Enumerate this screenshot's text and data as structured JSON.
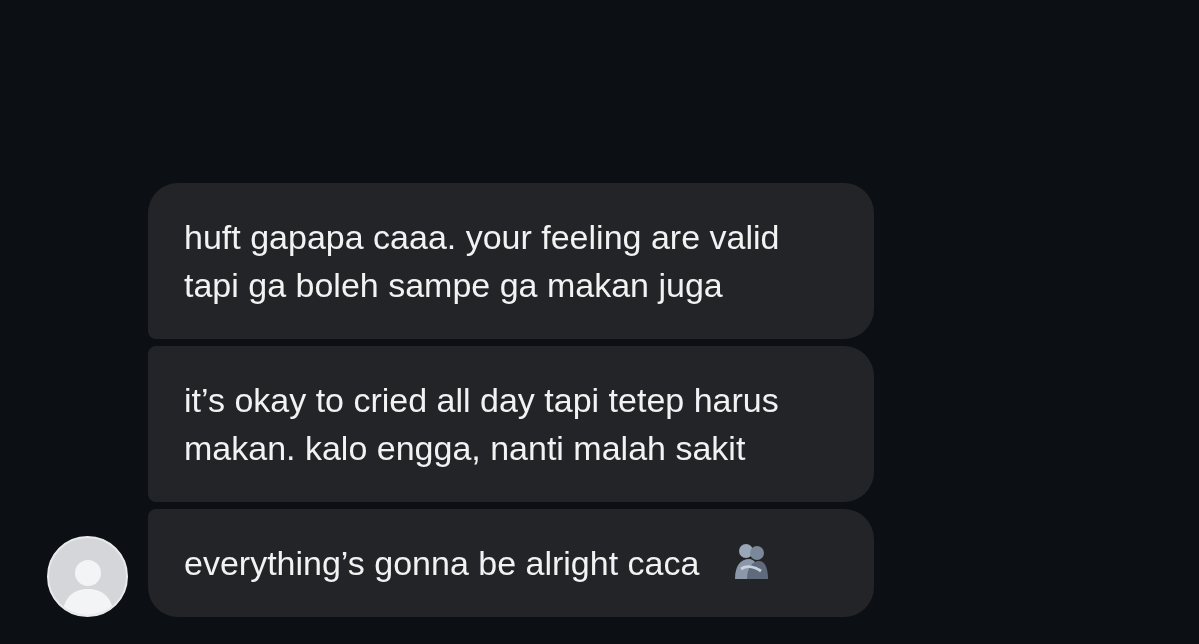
{
  "messages": [
    {
      "text": "huft gapapa caaa. your feeling are valid tapi ga boleh sampe ga makan juga"
    },
    {
      "text": "it’s okay to cried all day tapi tetep harus makan. kalo engga, nanti malah sakit"
    },
    {
      "text": "everything’s gonna be alright caca",
      "kind": "hug"
    }
  ]
}
